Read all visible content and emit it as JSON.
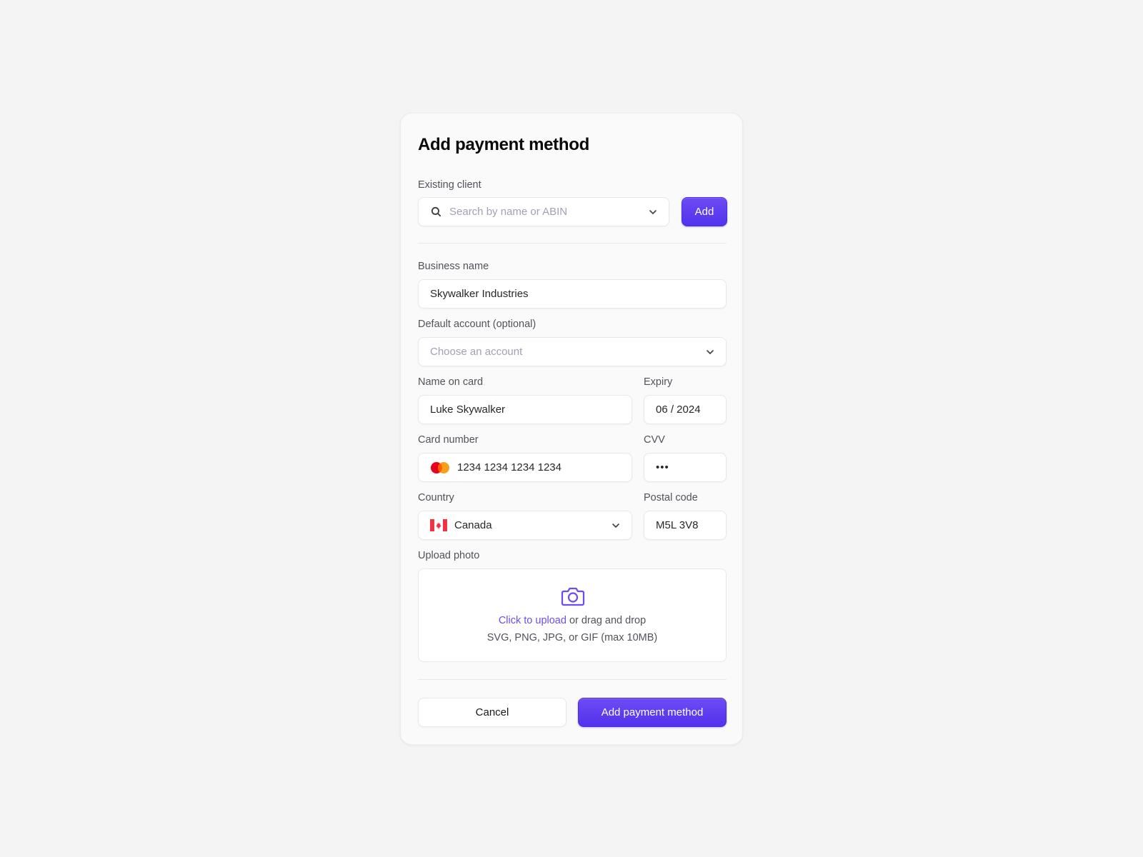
{
  "dialog": {
    "title": "Add payment method",
    "existing_client": {
      "label": "Existing client",
      "placeholder": "Search by name or ABIN",
      "add_label": "Add"
    },
    "business_name": {
      "label": "Business name",
      "value": "Skywalker Industries"
    },
    "default_account": {
      "label": "Default account (optional)",
      "placeholder": "Choose an account"
    },
    "name_on_card": {
      "label": "Name on card",
      "value": "Luke Skywalker"
    },
    "expiry": {
      "label": "Expiry",
      "value": "06 / 2024"
    },
    "card_number": {
      "label": "Card number",
      "value": "1234 1234 1234 1234",
      "brand_icon": "mastercard-icon"
    },
    "cvv": {
      "label": "CVV",
      "value": "•••"
    },
    "country": {
      "label": "Country",
      "value": "Canada",
      "flag_icon": "canada-flag-icon"
    },
    "postal_code": {
      "label": "Postal code",
      "value": "M5L 3V8"
    },
    "upload": {
      "label": "Upload photo",
      "link_text": "Click to upload",
      "rest_text": " or drag and drop",
      "hint": "SVG, PNG, JPG, or GIF (max 10MB)",
      "icon": "camera-icon"
    },
    "footer": {
      "cancel_label": "Cancel",
      "submit_label": "Add payment method"
    }
  },
  "colors": {
    "accent": "#5b3bf0",
    "background": "#f4f4f5",
    "card": "#fafafa"
  }
}
